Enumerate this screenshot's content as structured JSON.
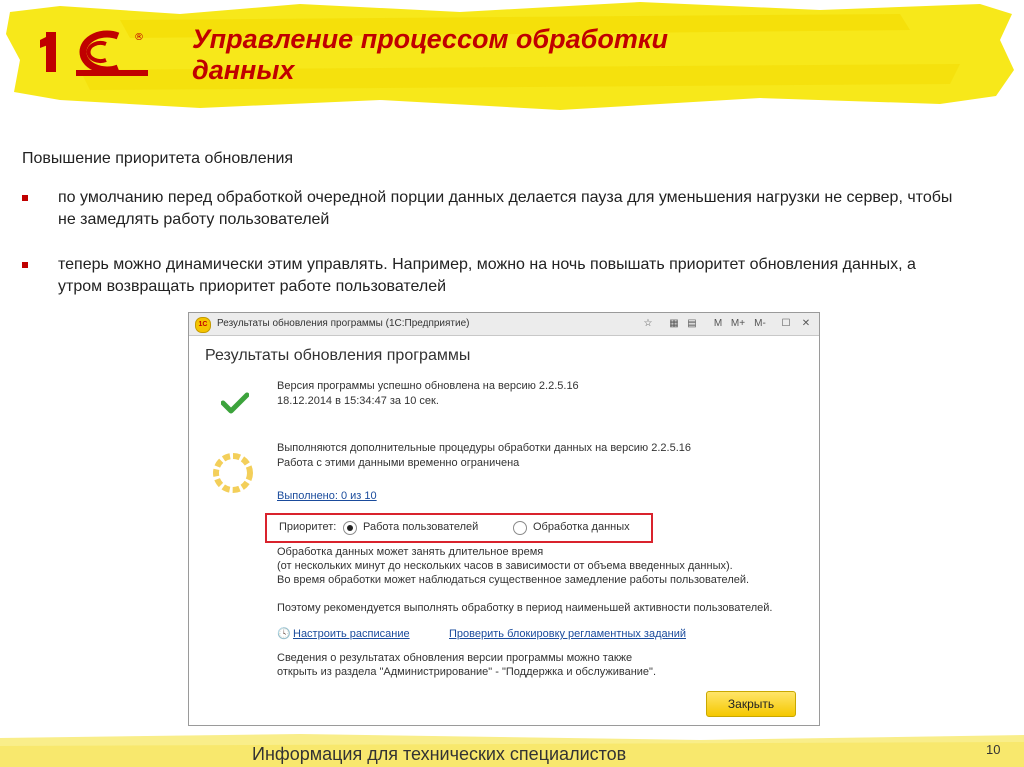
{
  "slide": {
    "title": "Управление процессом обработки данных",
    "subtitle": "Повышение приоритета обновления",
    "bullets": [
      "по умолчанию перед обработкой очередной порции данных делается пауза для уменьшения нагрузки не сервер, чтобы не замедлять работу пользователей",
      "теперь можно динамически этим управлять. Например, можно на ночь повышать приоритет обновления данных, а утром возвращать приоритет работе пользователей"
    ],
    "footer": "Информация для технических специалистов",
    "page_number": "10"
  },
  "logo": {
    "text": "1С",
    "mark": "®"
  },
  "window": {
    "title": "Результаты обновления программы (1С:Предприятие)",
    "toolbar": [
      "M",
      "M+",
      "M-"
    ],
    "heading": "Результаты обновления программы",
    "success": {
      "line1": "Версия программы успешно обновлена на версию 2.2.5.16",
      "line2": "18.12.2014 в 15:34:47 за 10 сек."
    },
    "processing": {
      "line1": "Выполняются дополнительные процедуры обработки данных на версию 2.2.5.16",
      "line2": "Работа с этими данными временно ограничена",
      "progress_link": "Выполнено: 0 из 10"
    },
    "priority": {
      "label": "Приоритет:",
      "options": [
        "Работа пользователей",
        "Обработка данных"
      ],
      "selected": "Работа пользователей"
    },
    "info": {
      "line1": "Обработка данных может занять длительное время",
      "line2": "(от нескольких минут до нескольких часов в зависимости от объема введенных данных).",
      "line3": "Во время обработки может наблюдаться существенное замедление работы пользователей.",
      "line4": "Поэтому рекомендуется выполнять обработку в период наименьшей активности пользователей."
    },
    "links": {
      "schedule": "Настроить расписание",
      "check_lock": "Проверить блокировку регламентных заданий"
    },
    "note": {
      "line1": "Сведения о результатах обновления версии программы можно также",
      "line2": "открыть из раздела \"Администрирование\" - \"Поддержка и обслуживание\"."
    },
    "close_button": "Закрыть"
  },
  "colors": {
    "title_red": "#c00000",
    "highlight_yellow": "#f5e000",
    "frame_red": "#d9232d",
    "link_blue": "#1a4b9c"
  }
}
